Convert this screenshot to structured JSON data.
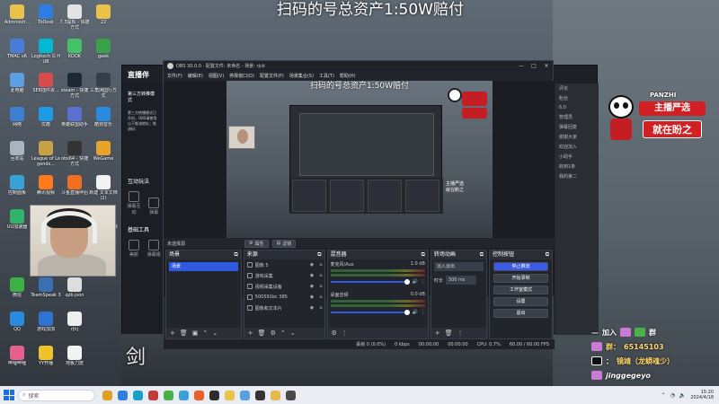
{
  "wallpaper": {
    "title": "扫码的号总资产1:50W赔付"
  },
  "desktop_icons": [
    {
      "label": "Administr...",
      "color": "#e9c24a",
      "col": 0,
      "row": 0
    },
    {
      "label": "TMAC v6",
      "color": "#4a7bd6",
      "col": 0,
      "row": 1
    },
    {
      "label": "此电脑",
      "color": "#5aa0e0",
      "col": 0,
      "row": 2
    },
    {
      "label": "网络",
      "color": "#3c7fd0",
      "col": 0,
      "row": 3
    },
    {
      "label": "回收站",
      "color": "#aab4c0",
      "col": 0,
      "row": 4
    },
    {
      "label": "控制面板",
      "color": "#3aa0d8",
      "col": 0,
      "row": 5
    },
    {
      "label": "UU加速器",
      "color": "#2fb46a",
      "col": 0,
      "row": 6
    },
    {
      "label": "微信",
      "color": "#3cb043",
      "col": 0,
      "row": 8
    },
    {
      "label": "QQ",
      "color": "#2a8ae0",
      "col": 0,
      "row": 9
    },
    {
      "label": "哔哩哔哩",
      "color": "#e5608a",
      "col": 0,
      "row": 10
    },
    {
      "label": "ToDesk",
      "color": "#2f7de1",
      "col": 1,
      "row": 0
    },
    {
      "label": "Logitech G HUB",
      "color": "#00b8d4",
      "col": 1,
      "row": 1
    },
    {
      "label": "SE8插件资...",
      "color": "#d84b4b",
      "col": 1,
      "row": 2
    },
    {
      "label": "优酷",
      "color": "#1f9be6",
      "col": 1,
      "row": 3
    },
    {
      "label": "League of Legends...",
      "color": "#c8a046",
      "col": 1,
      "row": 4
    },
    {
      "label": "腾讯视频",
      "color": "#ff7a1a",
      "col": 1,
      "row": 5
    },
    {
      "label": "Microsoft Edge",
      "color": "#1aa0c8",
      "col": 1,
      "row": 6
    },
    {
      "label": "TeamSpeak 3",
      "color": "#3a6fb0",
      "col": 1,
      "row": 8
    },
    {
      "label": "游戏加加",
      "color": "#2e74d0",
      "col": 1,
      "row": 9
    },
    {
      "label": "YY开播",
      "color": "#f0c22a",
      "col": 1,
      "row": 10
    },
    {
      "label": "7.3提现 - 快捷方式",
      "color": "#e3e3e3",
      "col": 2,
      "row": 0
    },
    {
      "label": "KOOK",
      "color": "#47c06a",
      "col": 2,
      "row": 1
    },
    {
      "label": "steam - 快捷方式",
      "color": "#1b2838",
      "col": 2,
      "row": 2
    },
    {
      "label": "英雄联盟助手",
      "color": "#5a6fd0",
      "col": 2,
      "row": 3
    },
    {
      "label": "obs64 - 快捷方式",
      "color": "#333333",
      "col": 2,
      "row": 4
    },
    {
      "label": "斗鱼直播伴侣",
      "color": "#f07020",
      "col": 2,
      "row": 5
    },
    {
      "label": "qzb.json",
      "color": "#dddddd",
      "col": 2,
      "row": 8
    },
    {
      "label": "rjhj",
      "color": "#eeeeee",
      "col": 2,
      "row": 9
    },
    {
      "label": "地板刀皮",
      "color": "#f2f2f2",
      "col": 2,
      "row": 10
    },
    {
      "label": "22",
      "color": "#e9c24a",
      "col": 3,
      "row": 0
    },
    {
      "label": "geek",
      "color": "#3aa04a",
      "col": 3,
      "row": 1
    },
    {
      "label": "三角洲国行方式",
      "color": "#333f4a",
      "col": 3,
      "row": 2
    },
    {
      "label": "酷狗音乐",
      "color": "#2a8ae0",
      "col": 3,
      "row": 3
    },
    {
      "label": "WeGame",
      "color": "#e8a42a",
      "col": 3,
      "row": 4
    },
    {
      "label": "新建 文本文档 (2)",
      "color": "#f2f2f2",
      "col": 3,
      "row": 5
    },
    {
      "label": "新建 文本文档 (3)",
      "color": "#f2f2f2",
      "col": 3,
      "row": 6
    }
  ],
  "stream_app": {
    "logo": "直播伴",
    "side_section_1": "第三方转推模式",
    "side_text": "第三方转播模式已开启，OBS请使用以下推流地址；推流码：",
    "side_interact": "互动玩法",
    "side_tools": "基础工具",
    "side_buttons": [
      "弹幕互动",
      "弹幕",
      "美颜",
      "弹幕姬"
    ],
    "right_texts": [
      "评论",
      "粉丝",
      "6.0",
      "管理员",
      "弹幕回复",
      "谢谢大家",
      "欢迎加入",
      "小助手",
      "收到1条",
      "我的第二"
    ]
  },
  "obs": {
    "title": "OBS 30.0.0 - 配置文件: 未命名 - 场景: rjcb",
    "menu": [
      "文件(F)",
      "编辑(E)",
      "视图(V)",
      "停靠窗口(D)",
      "配置文件(P)",
      "场景集合(S)",
      "工具(T)",
      "帮助(H)"
    ],
    "preview_title": "扫码的号总资产1:50W赔付",
    "preview_overlay_text": [
      "主播严选",
      "就在盼之"
    ],
    "no_source": "未选择源",
    "properties_label": "属性",
    "filters_label": "滤镜",
    "scenes": {
      "title": "场景",
      "items": [
        "场景"
      ]
    },
    "sources": {
      "title": "来源",
      "items": [
        {
          "name": "图像 5",
          "icon": "image-icon"
        },
        {
          "name": "游戏采集",
          "icon": "game-icon"
        },
        {
          "name": "视频采集设备",
          "icon": "camera-icon"
        },
        {
          "name": "500591bc 385",
          "icon": "media-icon"
        },
        {
          "name": "图像和文本片",
          "icon": "text-icon"
        }
      ]
    },
    "mixer": {
      "title": "混音器",
      "channels": [
        {
          "name": "麦克风/Aux",
          "level": "1.0 dB"
        },
        {
          "name": "桌面音频",
          "level": "0.0 dB"
        }
      ]
    },
    "transitions": {
      "title": "转场动画",
      "type": "淡入淡出",
      "duration_label": "时长",
      "duration": "300 ms"
    },
    "controls": {
      "title": "控制按钮",
      "buttons": [
        "停止推流",
        "开始录制",
        "工作室模式",
        "设置",
        "退出"
      ]
    },
    "status": {
      "dropped": "丢帧 0 (0.0%)",
      "bitrate": "0 kbps",
      "stream_time": "00:00:00",
      "rec_time": "00:00:00",
      "cpu": "CPU: 0.7%",
      "fps": "60.00 / 60.00 FPS"
    }
  },
  "overlay": {
    "brand": "PANZHI",
    "badge_1": "主播严选",
    "badge_2": "就在盼之",
    "contact": {
      "join": "加入",
      "group": "群",
      "qq_label": "群：",
      "qq_number": "65145103",
      "douyin_label": "：",
      "douyin_name": "镜靖（龙蟒魂少）",
      "handle": "jinggegeyo"
    },
    "sword_glyph": "剑"
  },
  "taskbar": {
    "search_placeholder": "搜索",
    "apps": [
      "#e0a020",
      "#2f7de1",
      "#1aa0c8",
      "#c03a3a",
      "#4ab04a",
      "#3aa0d8",
      "#e6602a",
      "#2d2d2d",
      "#e9c24a",
      "#5aa0e0",
      "#333333",
      "#e7b84a",
      "#4a4a4a"
    ],
    "time": "15:20",
    "date": "2024/4/18"
  }
}
